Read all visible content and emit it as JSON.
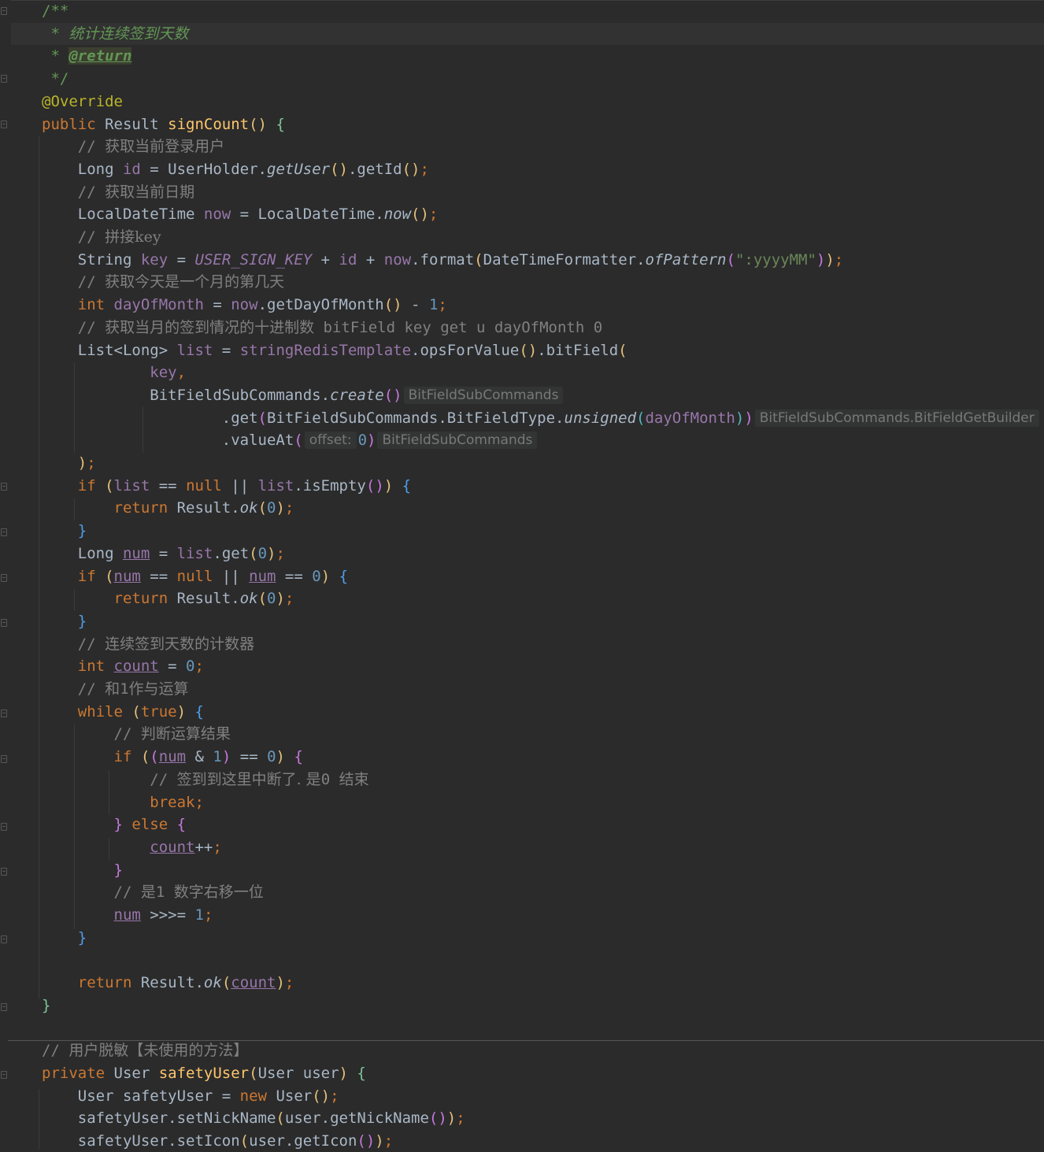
{
  "lines": [
    {
      "segments": [
        {
          "t": "/**",
          "c": "doc"
        }
      ]
    },
    {
      "segments": [
        {
          "t": " * ",
          "c": "doc"
        },
        {
          "t": "统计连续签到天数",
          "c": "doci"
        }
      ]
    },
    {
      "segments": [
        {
          "t": " * ",
          "c": "doc"
        },
        {
          "t": "@return",
          "c": "doctag"
        }
      ]
    },
    {
      "segments": [
        {
          "t": " */",
          "c": "doc"
        }
      ]
    },
    {
      "segments": [
        {
          "t": "@Override",
          "c": "ann"
        }
      ]
    },
    {
      "segments": [
        {
          "t": "public ",
          "c": "kw"
        },
        {
          "t": "Result "
        },
        {
          "t": "signCount",
          "c": "fn"
        },
        {
          "t": "()",
          "c": "p1"
        },
        {
          "t": " "
        },
        {
          "t": "{",
          "c": "pg"
        }
      ]
    },
    {
      "segments": [
        {
          "t": "    // ",
          "c": "cmm"
        },
        {
          "t": "获取当前登录用户",
          "c": "cm"
        }
      ]
    },
    {
      "segments": [
        {
          "t": "    Long "
        },
        {
          "t": "id",
          "c": "var"
        },
        {
          "t": " = UserHolder."
        },
        {
          "t": "getUser",
          "c": "st"
        },
        {
          "t": "()",
          "c": "p1"
        },
        {
          "t": ".getId"
        },
        {
          "t": "()",
          "c": "p1"
        },
        {
          "t": ";",
          "c": "kw"
        }
      ]
    },
    {
      "segments": [
        {
          "t": "    // ",
          "c": "cmm"
        },
        {
          "t": "获取当前日期",
          "c": "cm"
        }
      ]
    },
    {
      "segments": [
        {
          "t": "    LocalDateTime "
        },
        {
          "t": "now",
          "c": "var"
        },
        {
          "t": " = LocalDateTime."
        },
        {
          "t": "now",
          "c": "st"
        },
        {
          "t": "()",
          "c": "p1"
        },
        {
          "t": ";",
          "c": "kw"
        }
      ]
    },
    {
      "segments": [
        {
          "t": "    // ",
          "c": "cmm"
        },
        {
          "t": "拼接key",
          "c": "cm"
        }
      ]
    },
    {
      "segments": [
        {
          "t": "    String "
        },
        {
          "t": "key",
          "c": "var"
        },
        {
          "t": " = "
        },
        {
          "t": "USER_SIGN_KEY",
          "c": "const"
        },
        {
          "t": " + "
        },
        {
          "t": "id",
          "c": "var"
        },
        {
          "t": " + "
        },
        {
          "t": "now",
          "c": "var"
        },
        {
          "t": ".format"
        },
        {
          "t": "(",
          "c": "p1"
        },
        {
          "t": "DateTimeFormatter."
        },
        {
          "t": "ofPattern",
          "c": "st"
        },
        {
          "t": "(",
          "c": "p2"
        },
        {
          "t": "\":yyyyMM\"",
          "c": "str"
        },
        {
          "t": ")",
          "c": "p2"
        },
        {
          "t": ")",
          "c": "p1"
        },
        {
          "t": ";",
          "c": "kw"
        }
      ]
    },
    {
      "segments": [
        {
          "t": "    // ",
          "c": "cmm"
        },
        {
          "t": "获取今天是一个月的第几天",
          "c": "cm"
        }
      ]
    },
    {
      "segments": [
        {
          "t": "    int ",
          "c": "kw"
        },
        {
          "t": "dayOfMonth",
          "c": "var"
        },
        {
          "t": " = "
        },
        {
          "t": "now",
          "c": "var"
        },
        {
          "t": ".getDayOfMonth"
        },
        {
          "t": "()",
          "c": "p1"
        },
        {
          "t": " - "
        },
        {
          "t": "1",
          "c": "num"
        },
        {
          "t": ";",
          "c": "kw"
        }
      ]
    },
    {
      "segments": [
        {
          "t": "    // ",
          "c": "cmm"
        },
        {
          "t": "获取当月的签到情况的十进制数",
          "c": "cm"
        },
        {
          "t": " bitField key get u dayOfMonth 0",
          "c": "cmm"
        }
      ]
    },
    {
      "segments": [
        {
          "t": "    List<Long> "
        },
        {
          "t": "list",
          "c": "var"
        },
        {
          "t": " = "
        },
        {
          "t": "stringRedisTemplate",
          "c": "var"
        },
        {
          "t": ".opsForValue"
        },
        {
          "t": "()",
          "c": "p1"
        },
        {
          "t": ".bitField"
        },
        {
          "t": "(",
          "c": "p1"
        }
      ]
    },
    {
      "segments": [
        {
          "t": "            "
        },
        {
          "t": "key",
          "c": "var"
        },
        {
          "t": ",",
          "c": "kw"
        }
      ]
    },
    {
      "segments": [
        {
          "t": "            BitFieldSubCommands."
        },
        {
          "t": "create",
          "c": "st"
        },
        {
          "t": "()",
          "c": "p2"
        },
        {
          "t": "BitFieldSubCommands",
          "c": "hint"
        }
      ]
    },
    {
      "segments": [
        {
          "t": "                    .get"
        },
        {
          "t": "(",
          "c": "p2"
        },
        {
          "t": "BitFieldSubCommands.BitFieldType."
        },
        {
          "t": "unsigned",
          "c": "st"
        },
        {
          "t": "(",
          "c": "p3"
        },
        {
          "t": "dayOfMonth",
          "c": "var"
        },
        {
          "t": ")",
          "c": "p3"
        },
        {
          "t": ")",
          "c": "p2"
        },
        {
          "t": "BitFieldSubCommands.BitFieldGetBuilder",
          "c": "hint"
        }
      ]
    },
    {
      "segments": [
        {
          "t": "                    .valueAt"
        },
        {
          "t": "(",
          "c": "p2"
        },
        {
          "t": "offset:",
          "c": "hint"
        },
        {
          "t": "0",
          "c": "num"
        },
        {
          "t": ")",
          "c": "p2"
        },
        {
          "t": "BitFieldSubCommands",
          "c": "hint"
        }
      ]
    },
    {
      "segments": [
        {
          "t": "    "
        },
        {
          "t": ")",
          "c": "p1"
        },
        {
          "t": ";",
          "c": "kw"
        }
      ]
    },
    {
      "segments": [
        {
          "t": "    if ",
          "c": "kw"
        },
        {
          "t": "(",
          "c": "p1"
        },
        {
          "t": "list",
          "c": "var"
        },
        {
          "t": " == "
        },
        {
          "t": "null",
          "c": "kw"
        },
        {
          "t": " || "
        },
        {
          "t": "list",
          "c": "var"
        },
        {
          "t": ".isEmpty"
        },
        {
          "t": "()",
          "c": "p2"
        },
        {
          "t": ")",
          "c": "p1"
        },
        {
          "t": " "
        },
        {
          "t": "{",
          "c": "pb"
        }
      ]
    },
    {
      "segments": [
        {
          "t": "        return ",
          "c": "kw"
        },
        {
          "t": "Result."
        },
        {
          "t": "ok",
          "c": "st"
        },
        {
          "t": "(",
          "c": "p1"
        },
        {
          "t": "0",
          "c": "num"
        },
        {
          "t": ")",
          "c": "p1"
        },
        {
          "t": ";",
          "c": "kw"
        }
      ]
    },
    {
      "segments": [
        {
          "t": "    "
        },
        {
          "t": "}",
          "c": "pb"
        }
      ]
    },
    {
      "segments": [
        {
          "t": "    Long "
        },
        {
          "t": "num",
          "c": "var ul"
        },
        {
          "t": " = "
        },
        {
          "t": "list",
          "c": "var"
        },
        {
          "t": ".get"
        },
        {
          "t": "(",
          "c": "p1"
        },
        {
          "t": "0",
          "c": "num"
        },
        {
          "t": ")",
          "c": "p1"
        },
        {
          "t": ";",
          "c": "kw"
        }
      ]
    },
    {
      "segments": [
        {
          "t": "    if ",
          "c": "kw"
        },
        {
          "t": "(",
          "c": "p1"
        },
        {
          "t": "num",
          "c": "var ul"
        },
        {
          "t": " == "
        },
        {
          "t": "null",
          "c": "kw"
        },
        {
          "t": " || "
        },
        {
          "t": "num",
          "c": "var ul"
        },
        {
          "t": " == "
        },
        {
          "t": "0",
          "c": "num"
        },
        {
          "t": ")",
          "c": "p1"
        },
        {
          "t": " "
        },
        {
          "t": "{",
          "c": "pb"
        }
      ]
    },
    {
      "segments": [
        {
          "t": "        return ",
          "c": "kw"
        },
        {
          "t": "Result."
        },
        {
          "t": "ok",
          "c": "st"
        },
        {
          "t": "(",
          "c": "p1"
        },
        {
          "t": "0",
          "c": "num"
        },
        {
          "t": ")",
          "c": "p1"
        },
        {
          "t": ";",
          "c": "kw"
        }
      ]
    },
    {
      "segments": [
        {
          "t": "    "
        },
        {
          "t": "}",
          "c": "pb"
        }
      ]
    },
    {
      "segments": [
        {
          "t": "    // ",
          "c": "cmm"
        },
        {
          "t": "连续签到天数的计数器",
          "c": "cm"
        }
      ]
    },
    {
      "segments": [
        {
          "t": "    int ",
          "c": "kw"
        },
        {
          "t": "count",
          "c": "var ul"
        },
        {
          "t": " = "
        },
        {
          "t": "0",
          "c": "num"
        },
        {
          "t": ";",
          "c": "kw"
        }
      ]
    },
    {
      "segments": [
        {
          "t": "    // ",
          "c": "cmm"
        },
        {
          "t": "和",
          "c": "cm"
        },
        {
          "t": "1",
          "c": "cmm"
        },
        {
          "t": "作与运算",
          "c": "cm"
        }
      ]
    },
    {
      "segments": [
        {
          "t": "    while ",
          "c": "kw"
        },
        {
          "t": "(",
          "c": "p1"
        },
        {
          "t": "true",
          "c": "kw"
        },
        {
          "t": ")",
          "c": "p1"
        },
        {
          "t": " "
        },
        {
          "t": "{",
          "c": "pb"
        }
      ]
    },
    {
      "segments": [
        {
          "t": "        // ",
          "c": "cmm"
        },
        {
          "t": "判断运算结果",
          "c": "cm"
        }
      ]
    },
    {
      "segments": [
        {
          "t": "        if ",
          "c": "kw"
        },
        {
          "t": "(",
          "c": "p1"
        },
        {
          "t": "(",
          "c": "p2"
        },
        {
          "t": "num",
          "c": "var ul"
        },
        {
          "t": " & "
        },
        {
          "t": "1",
          "c": "num"
        },
        {
          "t": ")",
          "c": "p2"
        },
        {
          "t": " == "
        },
        {
          "t": "0",
          "c": "num"
        },
        {
          "t": ")",
          "c": "p1"
        },
        {
          "t": " "
        },
        {
          "t": "{",
          "c": "p2"
        }
      ]
    },
    {
      "segments": [
        {
          "t": "            // ",
          "c": "cmm"
        },
        {
          "t": "签到到这里中断了. 是",
          "c": "cm"
        },
        {
          "t": "0 ",
          "c": "cmm"
        },
        {
          "t": "结束",
          "c": "cm"
        }
      ]
    },
    {
      "segments": [
        {
          "t": "            break",
          "c": "kw"
        },
        {
          "t": ";",
          "c": "kw"
        }
      ]
    },
    {
      "segments": [
        {
          "t": "        "
        },
        {
          "t": "}",
          "c": "p2"
        },
        {
          "t": " else ",
          "c": "kw"
        },
        {
          "t": "{",
          "c": "p2"
        }
      ]
    },
    {
      "segments": [
        {
          "t": "            "
        },
        {
          "t": "count",
          "c": "var ul"
        },
        {
          "t": "++"
        },
        {
          "t": ";",
          "c": "kw"
        }
      ]
    },
    {
      "segments": [
        {
          "t": "        "
        },
        {
          "t": "}",
          "c": "p2"
        }
      ]
    },
    {
      "segments": [
        {
          "t": "        // ",
          "c": "cmm"
        },
        {
          "t": "是",
          "c": "cm"
        },
        {
          "t": "1 ",
          "c": "cmm"
        },
        {
          "t": "数字右移一位",
          "c": "cm"
        }
      ]
    },
    {
      "segments": [
        {
          "t": "        "
        },
        {
          "t": "num",
          "c": "var ul"
        },
        {
          "t": " >>>= "
        },
        {
          "t": "1",
          "c": "num"
        },
        {
          "t": ";",
          "c": "kw"
        }
      ]
    },
    {
      "segments": [
        {
          "t": "    "
        },
        {
          "t": "}",
          "c": "pb"
        }
      ]
    },
    {
      "segments": []
    },
    {
      "segments": [
        {
          "t": "    return ",
          "c": "kw"
        },
        {
          "t": "Result."
        },
        {
          "t": "ok",
          "c": "st"
        },
        {
          "t": "(",
          "c": "p1"
        },
        {
          "t": "count",
          "c": "var ul"
        },
        {
          "t": ")",
          "c": "p1"
        },
        {
          "t": ";",
          "c": "kw"
        }
      ]
    },
    {
      "segments": [
        {
          "t": "}",
          "c": "pg"
        }
      ]
    },
    {
      "segments": []
    },
    {
      "segments": [
        {
          "t": "// ",
          "c": "cmm"
        },
        {
          "t": "用户脱敏【未使用的方法】",
          "c": "cm"
        }
      ]
    },
    {
      "segments": [
        {
          "t": "private ",
          "c": "kw"
        },
        {
          "t": "User "
        },
        {
          "t": "safetyUser",
          "c": "fn"
        },
        {
          "t": "(",
          "c": "p1"
        },
        {
          "t": "User user"
        },
        {
          "t": ")",
          "c": "p1"
        },
        {
          "t": " "
        },
        {
          "t": "{",
          "c": "pg"
        }
      ]
    },
    {
      "segments": [
        {
          "t": "    User safetyUser = "
        },
        {
          "t": "new ",
          "c": "kw"
        },
        {
          "t": "User"
        },
        {
          "t": "()",
          "c": "p1"
        },
        {
          "t": ";",
          "c": "kw"
        }
      ]
    },
    {
      "segments": [
        {
          "t": "    safetyUser.setNickName"
        },
        {
          "t": "(",
          "c": "p1"
        },
        {
          "t": "user.getNickName"
        },
        {
          "t": "()",
          "c": "p2"
        },
        {
          "t": ")",
          "c": "p1"
        },
        {
          "t": ";",
          "c": "kw"
        }
      ]
    },
    {
      "segments": [
        {
          "t": "    safetyUser.setIcon"
        },
        {
          "t": "(",
          "c": "p1"
        },
        {
          "t": "user.getIcon"
        },
        {
          "t": "()",
          "c": "p2"
        },
        {
          "t": ")",
          "c": "p1"
        },
        {
          "t": ";",
          "c": "kw"
        }
      ]
    }
  ]
}
